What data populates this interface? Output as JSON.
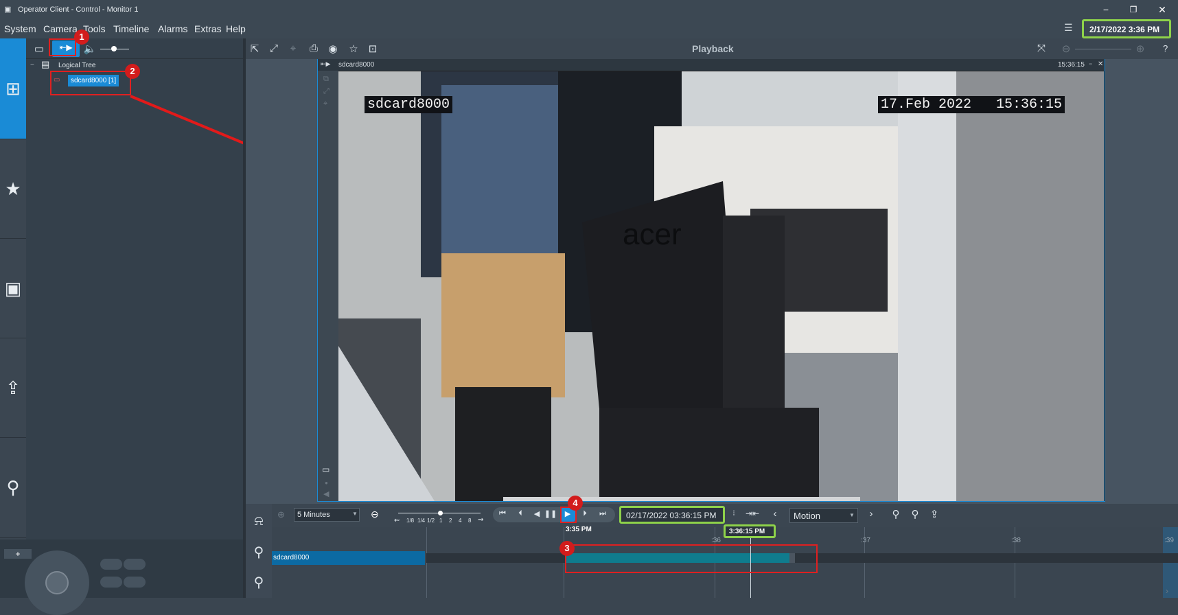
{
  "window": {
    "title": "Operator Client - Control - Monitor 1",
    "minimize": "−",
    "restore": "❐",
    "close": "✕"
  },
  "menu": [
    "System",
    "Camera",
    "Tools",
    "Timeline",
    "Alarms",
    "Extras",
    "Help"
  ],
  "clock": "2/17/2022 3:36 PM",
  "tree": {
    "root_label": "Logical Tree",
    "camera_item": "sdcard8000 [1]"
  },
  "viewer": {
    "mode_title": "Playback",
    "help": "?",
    "tile_name": "sdcard8000",
    "tile_time": "15:36:15",
    "osd_name": "sdcard8000",
    "osd_datetime": "17.Feb 2022   15:36:15",
    "monitor_brand": "acer"
  },
  "timeline": {
    "range_select": "5 Minutes",
    "speed_labels": [
      "1/8",
      "1/4",
      "1/2",
      "1",
      "2",
      "4",
      "8"
    ],
    "datetime_field": "02/17/2022 03:36:15 PM",
    "search_mode": "Motion",
    "time_marker_left": "3:35 PM",
    "cursor_time": "3:36:15 PM",
    "ticks": [
      ":36",
      ":37",
      ":38",
      ":39"
    ],
    "track_label": "sdcard8000",
    "recording_fraction": 0.3
  },
  "callouts": [
    "1",
    "2",
    "3",
    "4"
  ],
  "icons": {
    "plus": "+"
  },
  "colors": {
    "accent": "#1a8bd6",
    "callout_red": "#d21c1c",
    "highlight_green": "#8ed24a",
    "recording_bar": "#0f7c8e"
  }
}
